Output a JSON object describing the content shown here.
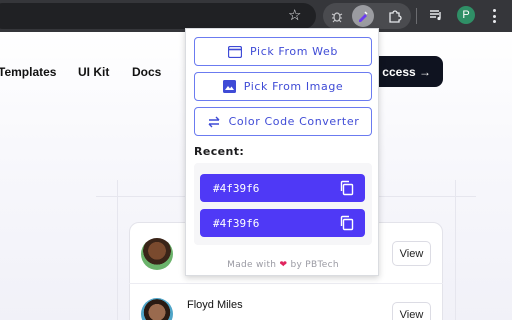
{
  "browser": {
    "bookmark_icon": "star-icon",
    "extensions": [
      "bug-icon",
      "color-picker-icon",
      "puzzle-icon"
    ],
    "profile_initial": "P"
  },
  "page": {
    "nav": [
      "Templates",
      "UI Kit",
      "Docs"
    ],
    "cta_label": "ccess →",
    "list": [
      {
        "name": "",
        "action": "View"
      },
      {
        "name": "Floyd Miles",
        "action": "View"
      }
    ]
  },
  "popup": {
    "buttons": {
      "pick_web": "Pick From Web",
      "pick_image": "Pick From Image",
      "converter": "Color Code Converter"
    },
    "recent_label": "Recent:",
    "recent_colors": [
      "#4f39f6",
      "#4f39f6"
    ],
    "footer_prefix": "Made with",
    "footer_heart": "❤",
    "footer_suffix": "by PBTech"
  },
  "colors": {
    "accent": "#4f39f6",
    "button_text": "#3f4bd6",
    "toolbar_bg": "#35363a"
  }
}
